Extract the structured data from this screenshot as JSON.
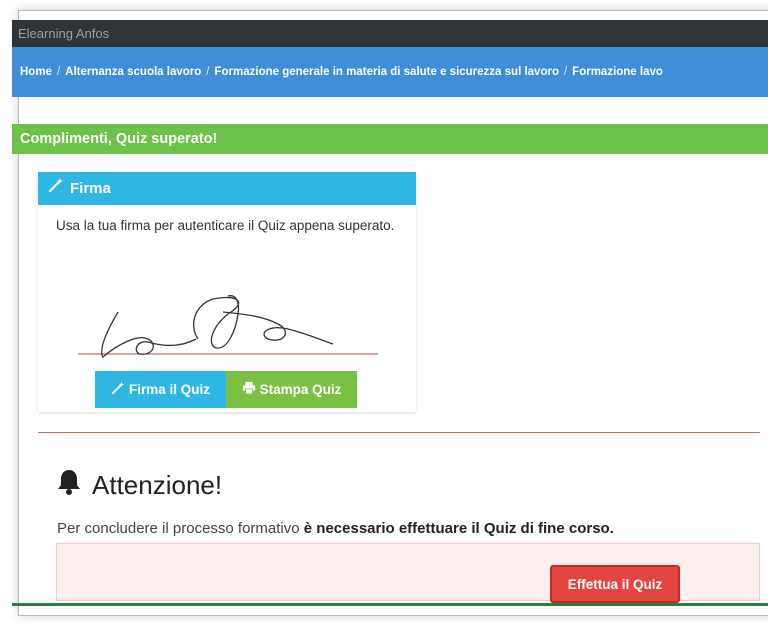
{
  "topbar": {
    "title": "Elearning Anfos"
  },
  "breadcrumb": {
    "items": [
      "Home",
      "Alternanza scuola lavoro",
      "Formazione generale in materia di salute e sicurezza sul lavoro",
      "Formazione lavo"
    ],
    "separator": "/"
  },
  "success": {
    "message": "Complimenti, Quiz superato!"
  },
  "signature_panel": {
    "title": "Firma",
    "icon": "magic-wand-icon",
    "description": "Usa la tua firma per autenticare il Quiz appena superato.",
    "sign_button": "Firma il Quiz",
    "print_button": "Stampa Quiz"
  },
  "attention": {
    "title": "Attenzione!",
    "icon": "bell-icon",
    "text_before": "Per concludere il processo formativo ",
    "text_bold": "è necessario effettuare il Quiz di fine corso.",
    "button": "Effettua il Quiz"
  },
  "colors": {
    "topbar": "#2f3438",
    "breadcrumb": "#3f8fd8",
    "success": "#6cc24a",
    "panel_header": "#2fb6e2",
    "print_button": "#7ac143",
    "danger": "#e3443d"
  }
}
